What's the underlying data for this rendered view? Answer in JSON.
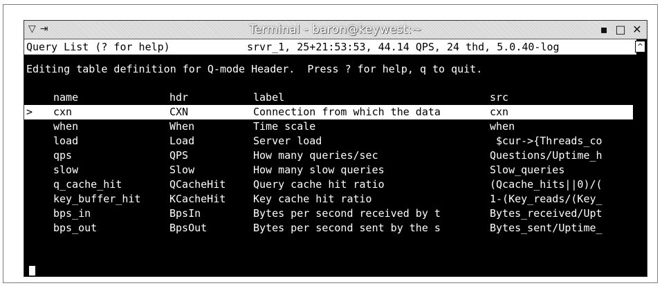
{
  "window": {
    "title": "Terminal - baron@keywest:~",
    "left_icons": [
      "▽",
      "⇥"
    ],
    "controls": {
      "minimize": "▪",
      "maximize": "□",
      "close": "✕"
    }
  },
  "status_line": {
    "left": "Query List (? for help)",
    "right": "srvr_1, 25+21:53:53, 44.14 QPS, 24 thd, 5.0.40-log"
  },
  "scroll_up_icon": "^",
  "message": "Editing table definition for Q-mode Header.  Press ? for help, q to quit.",
  "table": {
    "headers": {
      "name": "name",
      "hdr": "hdr",
      "label": "label",
      "src": "src"
    },
    "selected_marker": ">",
    "rows": [
      {
        "name": "cxn",
        "hdr": "CXN",
        "label": "Connection from which the data",
        "src": "cxn"
      },
      {
        "name": "when",
        "hdr": "When",
        "label": "Time scale",
        "src": "when"
      },
      {
        "name": "load",
        "hdr": "Load",
        "label": "Server load",
        "src": " $cur->{Threads_co"
      },
      {
        "name": "qps",
        "hdr": "QPS",
        "label": "How many queries/sec",
        "src": "Questions/Uptime_h"
      },
      {
        "name": "slow",
        "hdr": "Slow",
        "label": "How many slow queries",
        "src": "Slow_queries"
      },
      {
        "name": "q_cache_hit",
        "hdr": "QCacheHit",
        "label": "Query cache hit ratio",
        "src": "(Qcache_hits||0)/("
      },
      {
        "name": "key_buffer_hit",
        "hdr": "KCacheHit",
        "label": "Key cache hit ratio",
        "src": "1-(Key_reads/(Key_"
      },
      {
        "name": "bps_in",
        "hdr": "BpsIn",
        "label": "Bytes per second received by t",
        "src": "Bytes_received/Upt"
      },
      {
        "name": "bps_out",
        "hdr": "BpsOut",
        "label": "Bytes per second sent by the s",
        "src": "Bytes_sent/Uptime_"
      }
    ]
  }
}
